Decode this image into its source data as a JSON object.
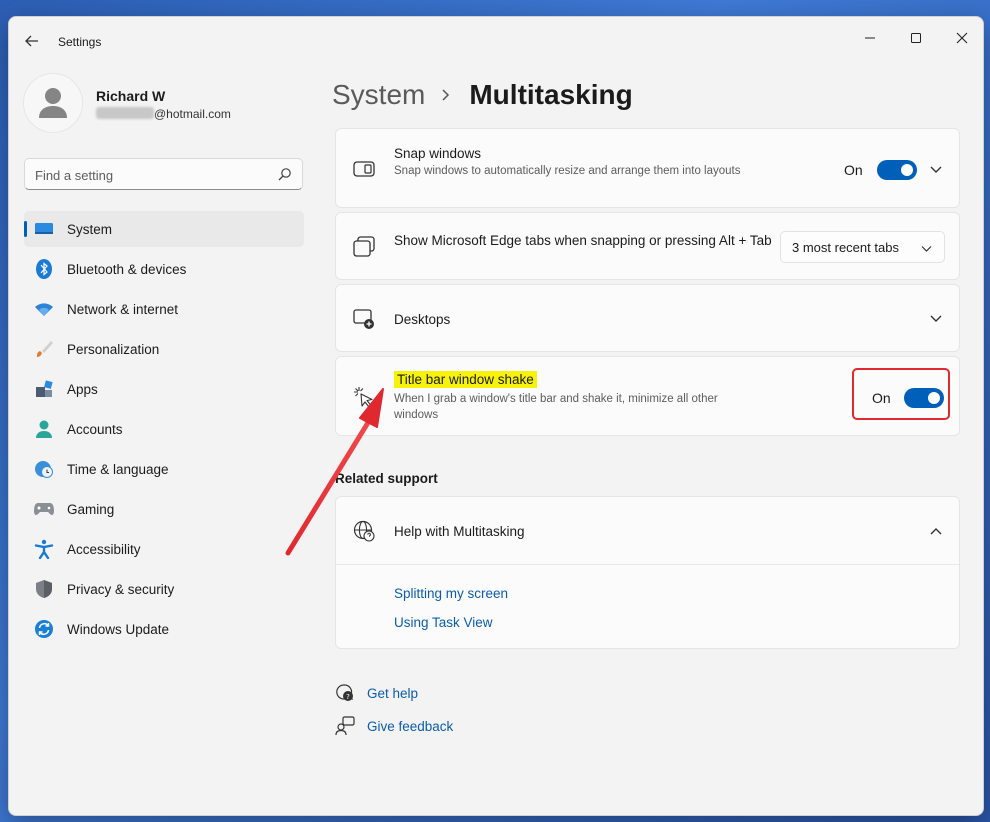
{
  "window": {
    "title": "Settings"
  },
  "profile": {
    "name": "Richard W",
    "email_suffix": "@hotmail.com"
  },
  "search": {
    "placeholder": "Find a setting"
  },
  "sidebar": {
    "items": [
      {
        "label": "System",
        "icon": "system-icon",
        "active": true
      },
      {
        "label": "Bluetooth & devices",
        "icon": "bluetooth-icon"
      },
      {
        "label": "Network & internet",
        "icon": "wifi-icon"
      },
      {
        "label": "Personalization",
        "icon": "brush-icon"
      },
      {
        "label": "Apps",
        "icon": "apps-icon"
      },
      {
        "label": "Accounts",
        "icon": "account-icon"
      },
      {
        "label": "Time & language",
        "icon": "globe-clock-icon"
      },
      {
        "label": "Gaming",
        "icon": "gamepad-icon"
      },
      {
        "label": "Accessibility",
        "icon": "accessibility-icon"
      },
      {
        "label": "Privacy & security",
        "icon": "shield-icon"
      },
      {
        "label": "Windows Update",
        "icon": "update-icon"
      }
    ]
  },
  "breadcrumb": {
    "parent": "System",
    "current": "Multitasking"
  },
  "cards": {
    "snap": {
      "title": "Snap windows",
      "description": "Snap windows to automatically resize and arrange them into layouts",
      "toggle_label": "On"
    },
    "edge": {
      "title": "Show Microsoft Edge tabs when snapping or pressing Alt + Tab",
      "dropdown_value": "3 most recent tabs"
    },
    "desktops": {
      "title": "Desktops"
    },
    "shake": {
      "title": "Title bar window shake",
      "description": "When I grab a window's title bar and shake it, minimize all other windows",
      "toggle_label": "On"
    }
  },
  "related": {
    "heading": "Related support",
    "help_title": "Help with Multitasking",
    "links": [
      "Splitting my screen",
      "Using Task View"
    ]
  },
  "footer": {
    "get_help": "Get help",
    "give_feedback": "Give feedback"
  },
  "colors": {
    "accent": "#005fb8",
    "highlight": "#f7f20c",
    "annotation": "#e0292e"
  }
}
